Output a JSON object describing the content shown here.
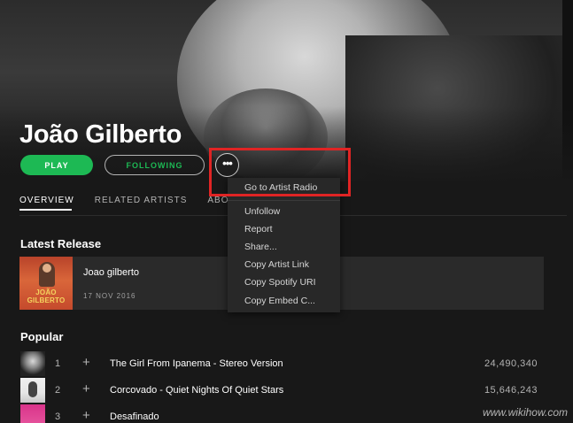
{
  "artist": {
    "name": "João Gilberto"
  },
  "actions": {
    "play_label": "PLAY",
    "following_label": "FOLLOWING",
    "more_label": "•••"
  },
  "tabs": [
    {
      "label": "OVERVIEW",
      "active": true
    },
    {
      "label": "RELATED ARTISTS",
      "active": false
    },
    {
      "label": "ABO",
      "active": false
    }
  ],
  "latest_release": {
    "section_title": "Latest Release",
    "title": "Joao gilberto",
    "date": "17 NOV 2016",
    "art_text": "JOÃO GILBERTO"
  },
  "popular": {
    "section_title": "Popular",
    "tracks": [
      {
        "num": "1",
        "add": "+",
        "title": "The Girl From Ipanema - Stereo Version",
        "plays": "24,490,340"
      },
      {
        "num": "2",
        "add": "+",
        "title": "Corcovado - Quiet Nights Of Quiet Stars",
        "plays": "15,646,243"
      },
      {
        "num": "3",
        "add": "+",
        "title": "Desafinado",
        "plays": ""
      }
    ]
  },
  "context_menu": {
    "items": [
      "Go to Artist Radio",
      "Unfollow",
      "Report",
      "Share...",
      "Copy Artist Link",
      "Copy Spotify URI",
      "Copy Embed C..."
    ]
  },
  "watermark": "www.wikihow.com",
  "colors": {
    "accent_green": "#1db954",
    "highlight_red": "#e02424",
    "background": "#181818",
    "menu_bg": "#282828"
  }
}
